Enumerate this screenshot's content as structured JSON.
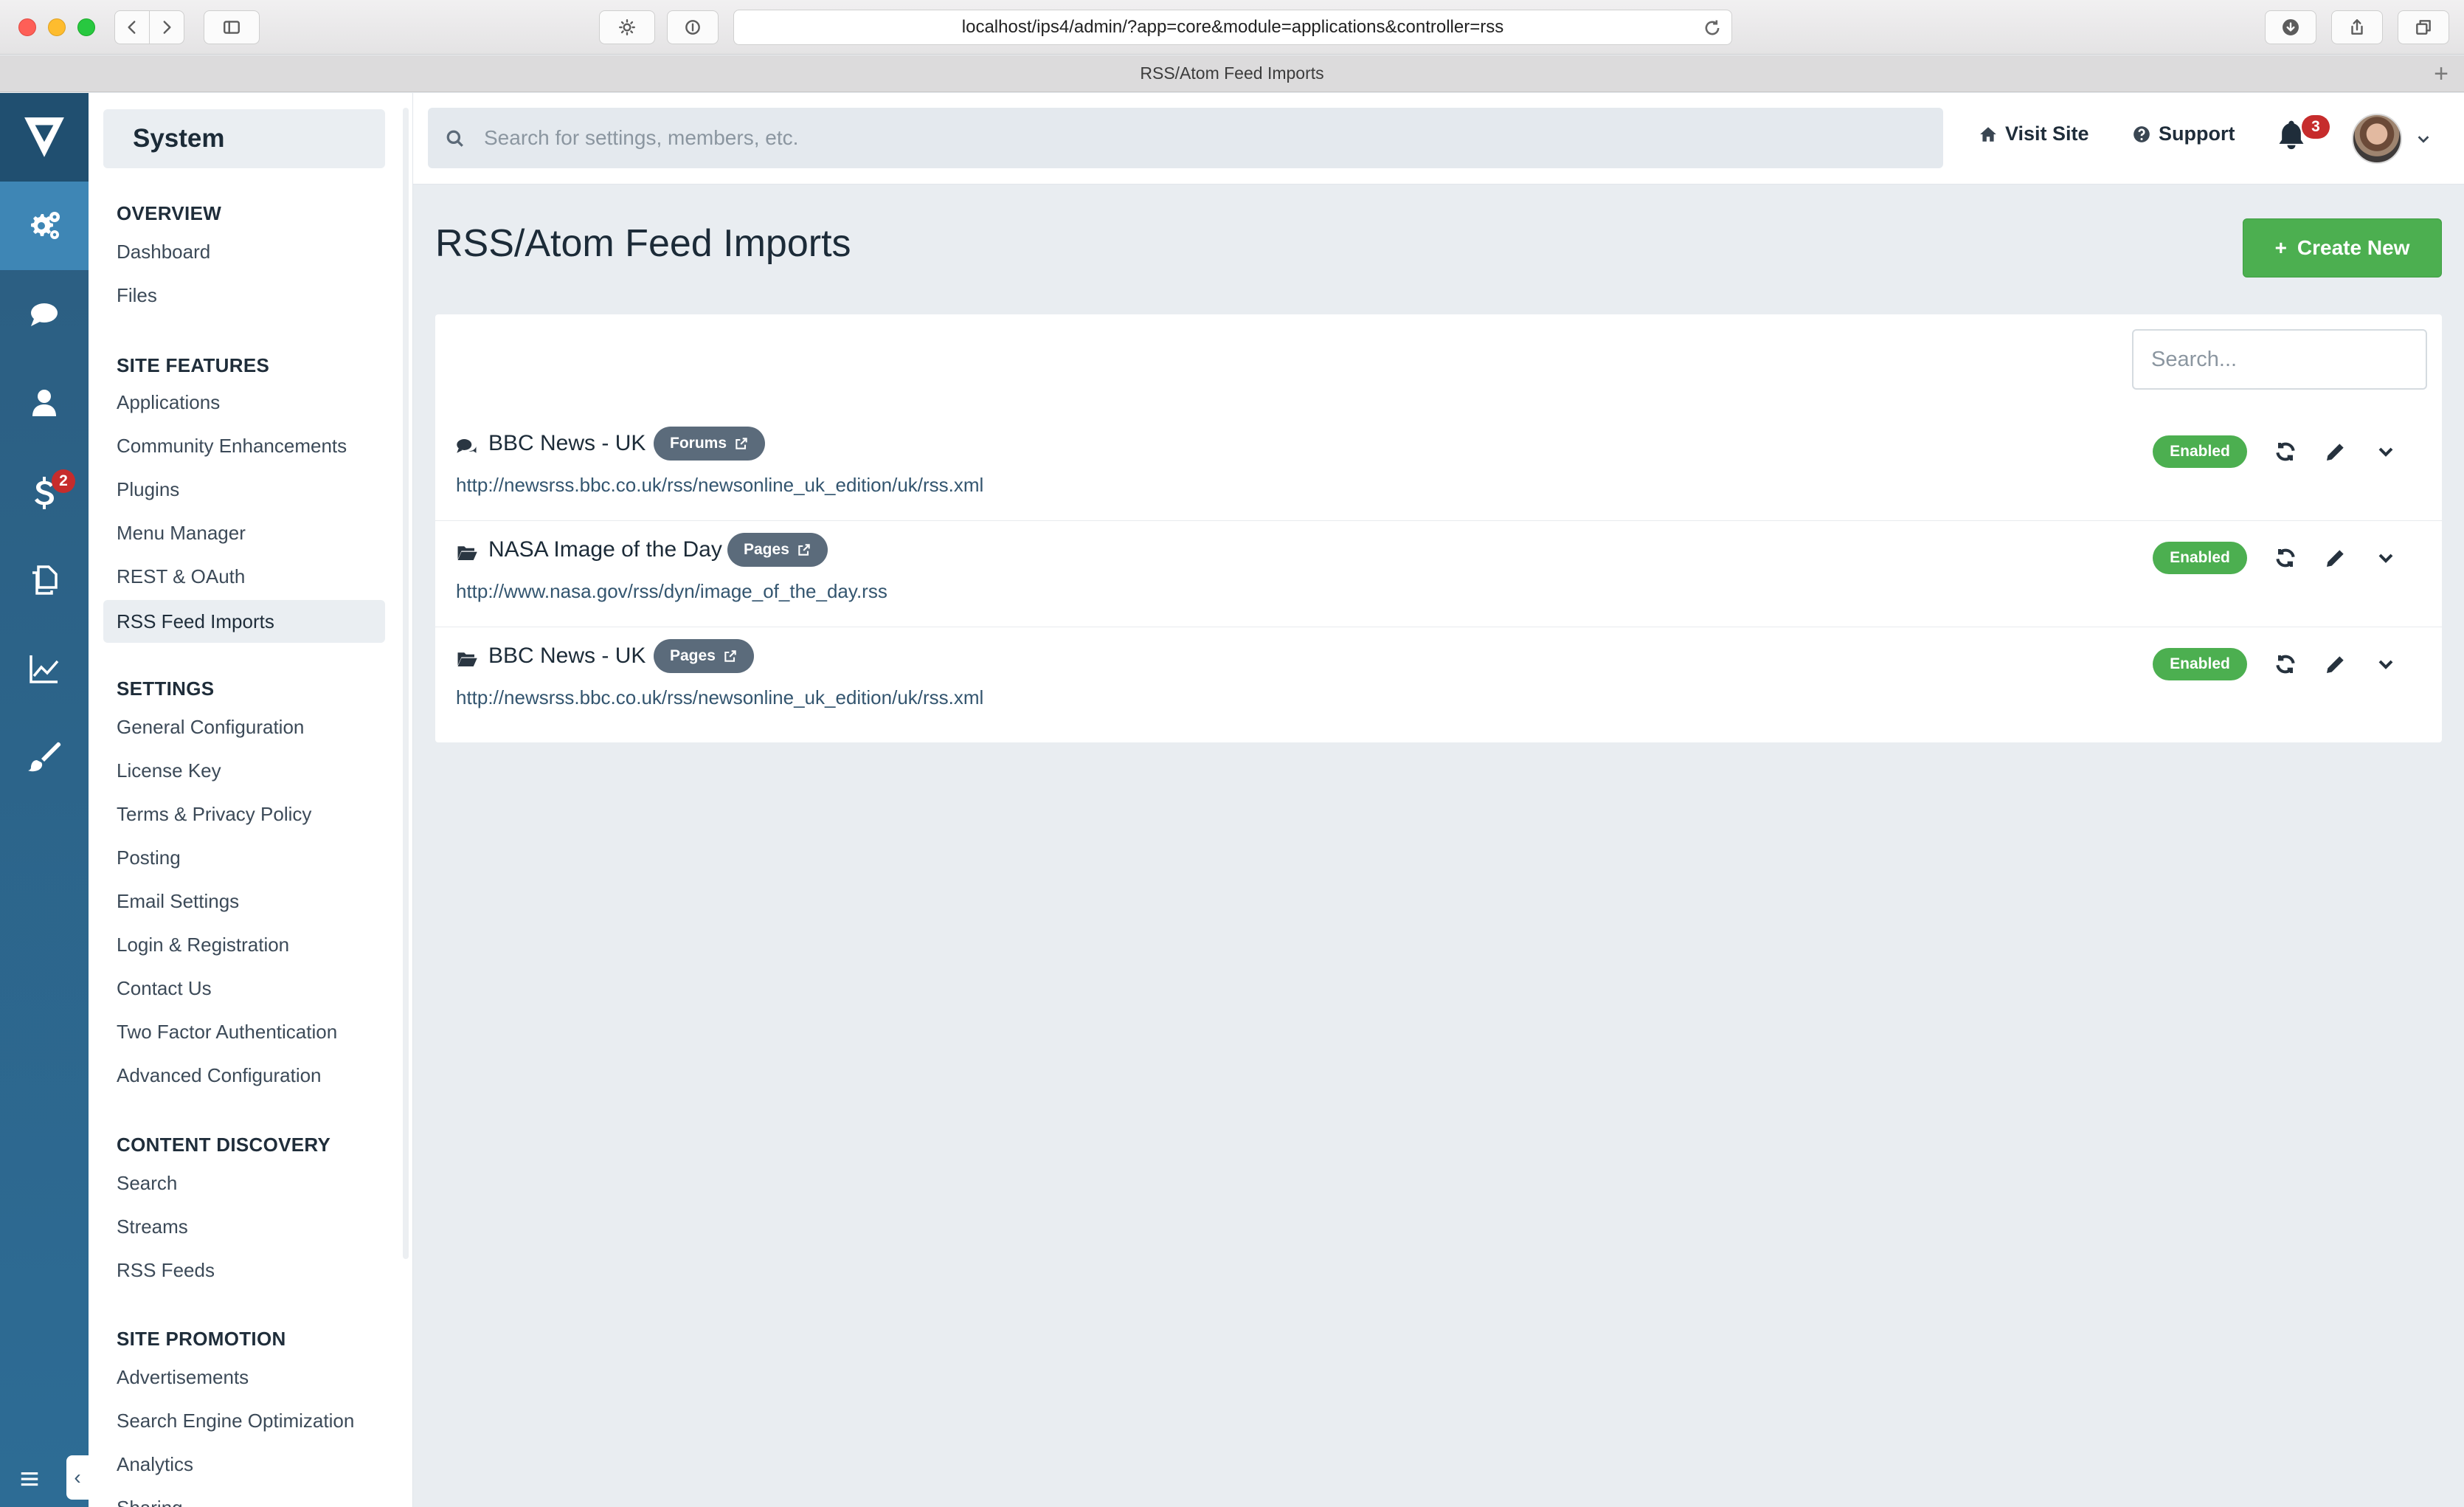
{
  "browser": {
    "url": "localhost/ips4/admin/?app=core&module=applications&controller=rss",
    "tab_title": "RSS/Atom Feed Imports"
  },
  "rail": {
    "items": [
      {
        "icon": "gears-icon",
        "active": true
      },
      {
        "icon": "chat-icon"
      },
      {
        "icon": "user-icon"
      },
      {
        "icon": "dollar-icon",
        "badge": "2"
      },
      {
        "icon": "copy-icon"
      },
      {
        "icon": "line-chart-icon"
      },
      {
        "icon": "brush-icon"
      }
    ]
  },
  "menu": {
    "title": "System",
    "sections": [
      {
        "heading": "OVERVIEW",
        "items": [
          "Dashboard",
          "Files"
        ]
      },
      {
        "heading": "SITE FEATURES",
        "items": [
          "Applications",
          "Community Enhancements",
          "Plugins",
          "Menu Manager",
          "REST & OAuth",
          "RSS Feed Imports"
        ]
      },
      {
        "heading": "SETTINGS",
        "items": [
          "General Configuration",
          "License Key",
          "Terms & Privacy Policy",
          "Posting",
          "Email Settings",
          "Login & Registration",
          "Contact Us",
          "Two Factor Authentication",
          "Advanced Configuration"
        ]
      },
      {
        "heading": "CONTENT DISCOVERY",
        "items": [
          "Search",
          "Streams",
          "RSS Feeds"
        ]
      },
      {
        "heading": "SITE PROMOTION",
        "items": [
          "Advertisements",
          "Search Engine Optimization",
          "Analytics",
          "Sharing"
        ]
      }
    ],
    "active_item": "RSS Feed Imports"
  },
  "header": {
    "search_placeholder": "Search for settings, members, etc.",
    "visit_site": "Visit Site",
    "support": "Support",
    "notification_count": "3"
  },
  "page": {
    "title": "RSS/Atom Feed Imports",
    "create_new": "Create New",
    "table_search_placeholder": "Search...",
    "feeds": [
      {
        "title": "BBC News - UK",
        "badge": "Forums",
        "url": "http://newsrss.bbc.co.uk/rss/newsonline_uk_edition/uk/rss.xml",
        "status": "Enabled",
        "icon": "comments-icon"
      },
      {
        "title": "NASA Image of the Day",
        "badge": "Pages",
        "url": "http://www.nasa.gov/rss/dyn/image_of_the_day.rss",
        "status": "Enabled",
        "icon": "folder-open-icon"
      },
      {
        "title": "BBC News - UK",
        "badge": "Pages",
        "url": "http://newsrss.bbc.co.uk/rss/newsonline_uk_edition/uk/rss.xml",
        "status": "Enabled",
        "icon": "folder-open-icon"
      }
    ]
  },
  "colors": {
    "rail": "#2c5d80",
    "rail_active": "#3e86b5",
    "accent_green": "#4caf50",
    "badge_gray": "#5b6b7b",
    "alert_red": "#c62c2c"
  }
}
